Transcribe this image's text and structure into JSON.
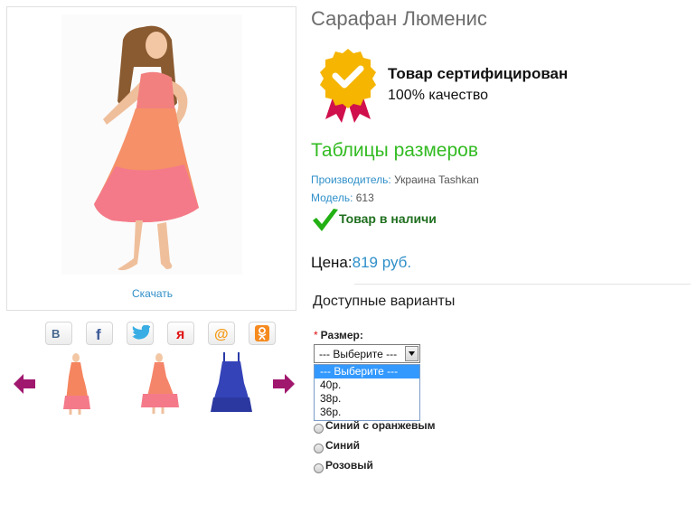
{
  "product": {
    "title": "Сарафан Люменис",
    "download_label": "Скачать"
  },
  "certificate": {
    "title": "Товар сертифицирован",
    "subtitle": "100% качество",
    "colors": {
      "badge": "#f5b500",
      "ribbon": "#d0104c"
    }
  },
  "size_tables_label": "Таблицы размеров",
  "manufacturer": {
    "label": "Производитель:",
    "value": " Украина Tashkan"
  },
  "model": {
    "label": "Модель:",
    "value": " 613"
  },
  "stock_status": "Товар в наличи",
  "price": {
    "label": "Цена:",
    "value": "819 руб."
  },
  "variants": {
    "title": "Доступные варианты",
    "size": {
      "required_mark": "*",
      "label": "Размер:",
      "selected": "--- Выберите ---",
      "options": [
        "--- Выберите ---",
        "40р.",
        "38р.",
        "36р."
      ]
    },
    "colors": [
      "Синий с оранжевым",
      "Синий",
      "Розовый"
    ]
  },
  "share_buttons": [
    "vk-icon",
    "facebook-icon",
    "twitter-icon",
    "yandex-icon",
    "mail-ru-icon",
    "odnoklassniki-icon"
  ],
  "theme": {
    "link": "#2f8fc9",
    "accent_green": "#33bb22",
    "arrow": "#a0186e"
  }
}
